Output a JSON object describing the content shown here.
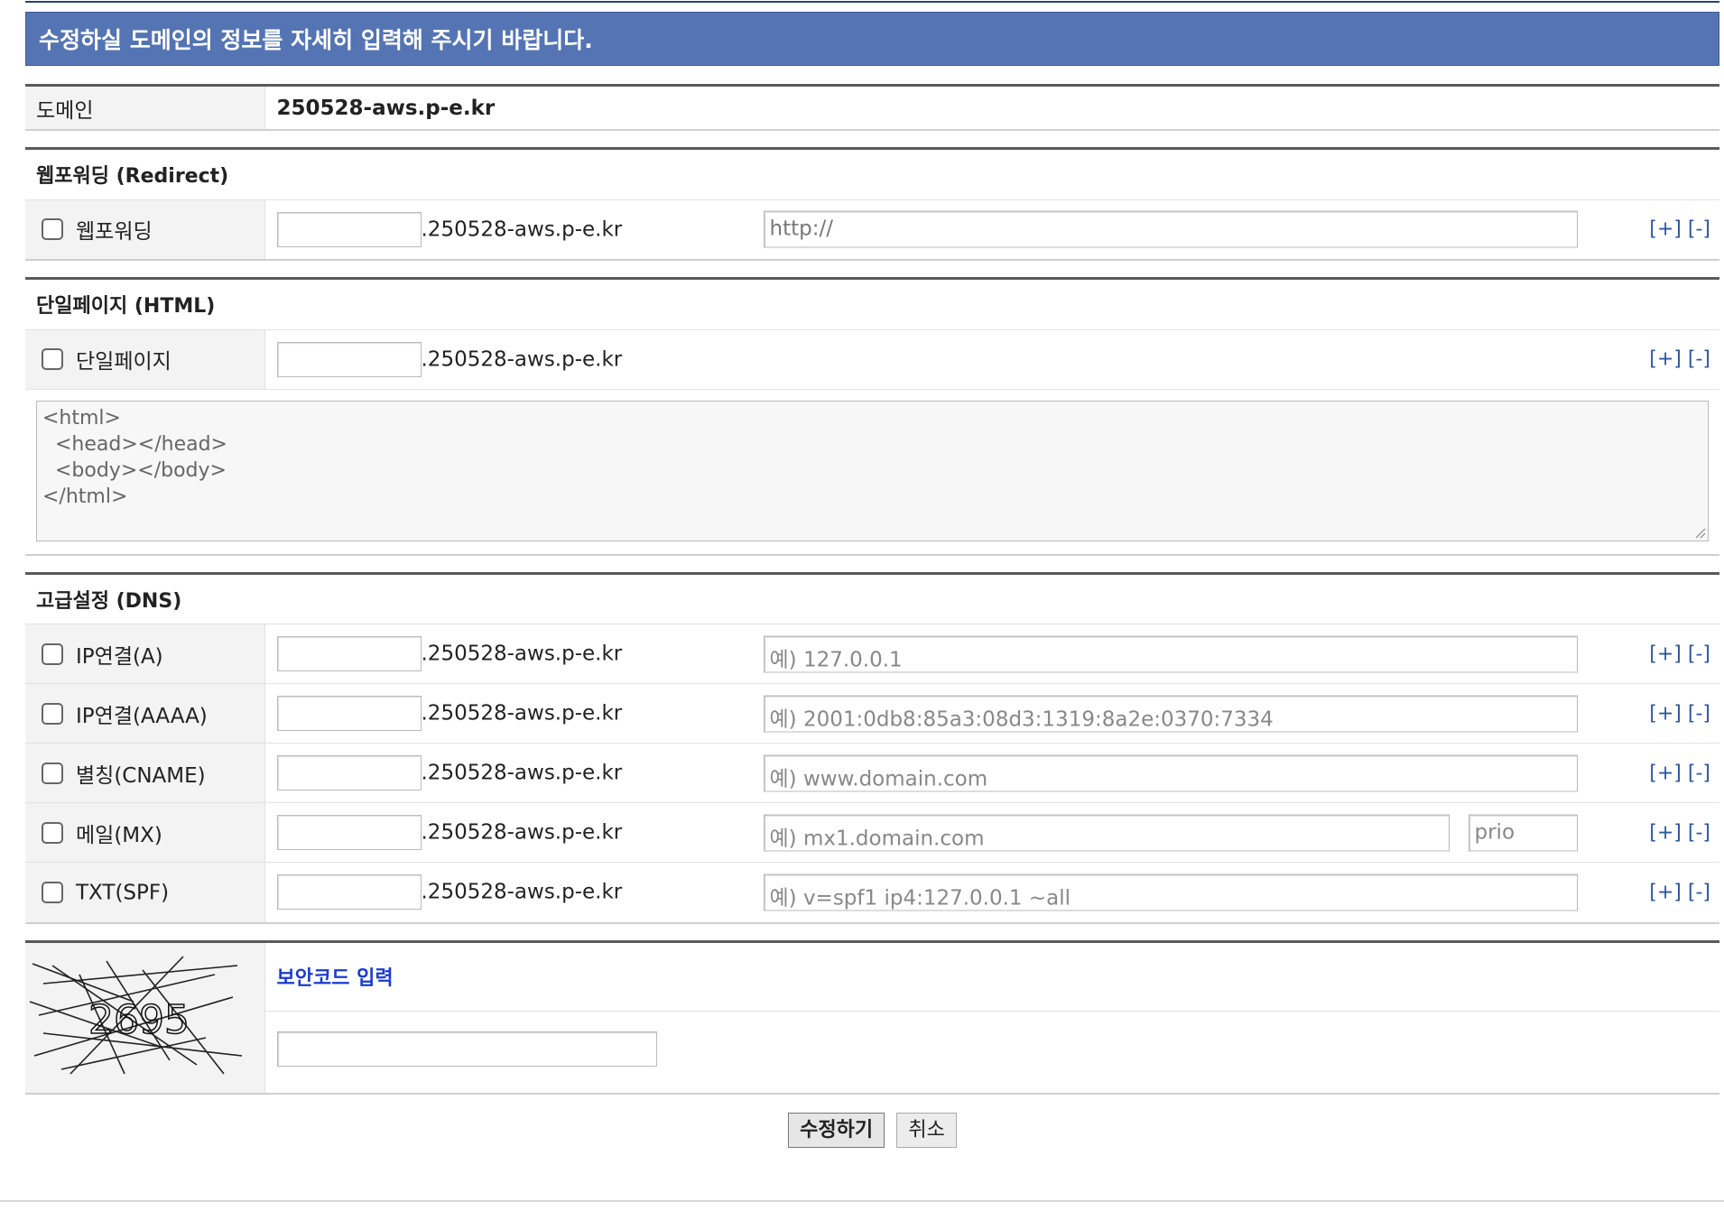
{
  "banner": {
    "text": "수정하실 도메인의 정보를 자세히 입력해 주시기 바랍니다."
  },
  "domain": {
    "label": "도메인",
    "value": "250528-aws.p-e.kr"
  },
  "redirect": {
    "title": "웹포워딩 (Redirect)",
    "row": {
      "label": "웹포워딩",
      "suffix": ".250528-aws.p-e.kr",
      "value": "http://",
      "plus": "[+]",
      "minus": "[-]"
    }
  },
  "html_page": {
    "title": "단일페이지 (HTML)",
    "row": {
      "label": "단일페이지",
      "suffix": ".250528-aws.p-e.kr",
      "plus": "[+]",
      "minus": "[-]"
    },
    "textarea": "<html>\n  <head></head>\n  <body></body>\n</html>"
  },
  "dns": {
    "title": "고급설정 (DNS)",
    "rows": [
      {
        "label": "IP연결(A)",
        "suffix": ".250528-aws.p-e.kr",
        "placeholder": "예) 127.0.0.1",
        "plus": "[+]",
        "minus": "[-]"
      },
      {
        "label": "IP연결(AAAA)",
        "suffix": ".250528-aws.p-e.kr",
        "placeholder": "예) 2001:0db8:85a3:08d3:1319:8a2e:0370:7334",
        "plus": "[+]",
        "minus": "[-]"
      },
      {
        "label": "별칭(CNAME)",
        "suffix": ".250528-aws.p-e.kr",
        "placeholder": "예) www.domain.com",
        "plus": "[+]",
        "minus": "[-]"
      },
      {
        "label": "메일(MX)",
        "suffix": ".250528-aws.p-e.kr",
        "placeholder": "예) mx1.domain.com",
        "prio": "prio",
        "plus": "[+]",
        "minus": "[-]"
      },
      {
        "label": "TXT(SPF)",
        "suffix": ".250528-aws.p-e.kr",
        "placeholder": "예) v=spf1 ip4:127.0.0.1 ~all",
        "plus": "[+]",
        "minus": "[-]"
      }
    ]
  },
  "captcha": {
    "title": "보안코드 입력",
    "code": "2695"
  },
  "buttons": {
    "submit": "수정하기",
    "cancel": "취소"
  }
}
